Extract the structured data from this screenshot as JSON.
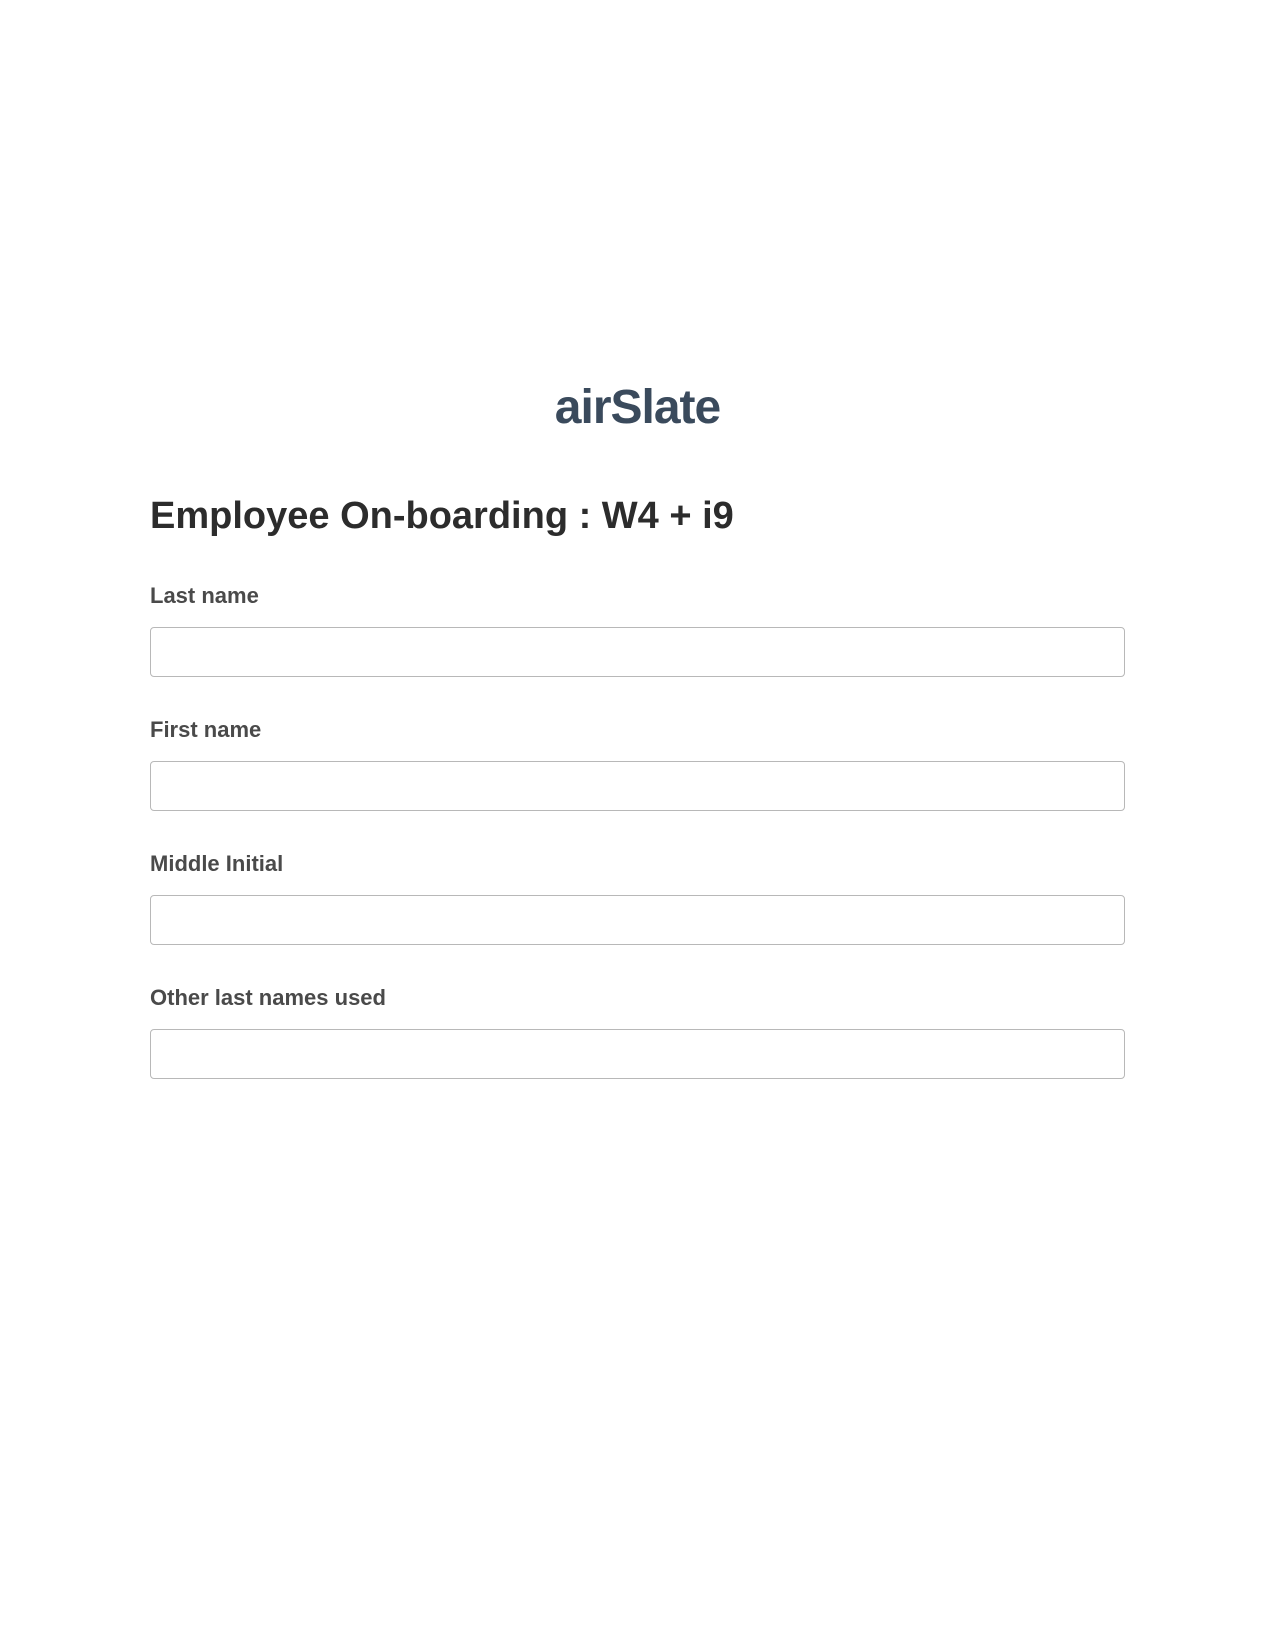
{
  "logo": {
    "text": "airSlate"
  },
  "form": {
    "title": "Employee On-boarding : W4 + i9",
    "fields": {
      "last_name": {
        "label": "Last name",
        "value": ""
      },
      "first_name": {
        "label": "First name",
        "value": ""
      },
      "middle_initial": {
        "label": "Middle Initial",
        "value": ""
      },
      "other_last_names": {
        "label": "Other last names used",
        "value": ""
      }
    }
  }
}
